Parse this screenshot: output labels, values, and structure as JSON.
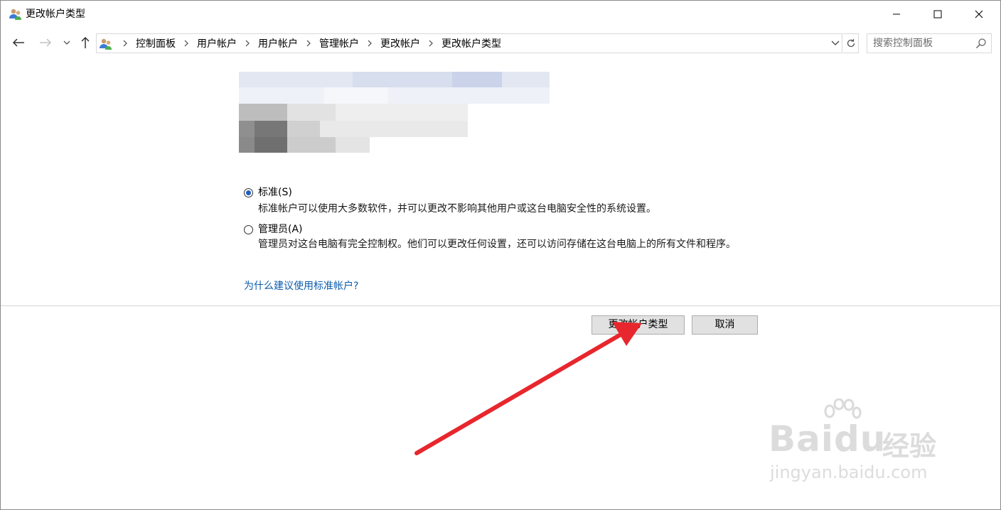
{
  "window": {
    "title": "更改帐户类型"
  },
  "nav": {
    "breadcrumbs": [
      "控制面板",
      "用户帐户",
      "用户帐户",
      "管理帐户",
      "更改帐户",
      "更改帐户类型"
    ],
    "search_placeholder": "搜索控制面板"
  },
  "options": [
    {
      "label": "标准(S)",
      "selected": true,
      "description": "标准帐户可以使用大多数软件，并可以更改不影响其他用户或这台电脑安全性的系统设置。"
    },
    {
      "label": "管理员(A)",
      "selected": false,
      "description": "管理员对这台电脑有完全控制权。他们可以更改任何设置，还可以访问存储在这台电脑上的所有文件和程序。"
    }
  ],
  "help_link": "为什么建议使用标准帐户?",
  "buttons": {
    "change": "更改帐户类型",
    "cancel": "取消"
  },
  "watermark": {
    "brand": "Baidu",
    "cn": "经验",
    "site": "jingyan.baidu.com"
  },
  "colors": {
    "accent": "#1b5fbf",
    "link": "#0b5cad",
    "annotation_arrow": "#e8262d"
  }
}
